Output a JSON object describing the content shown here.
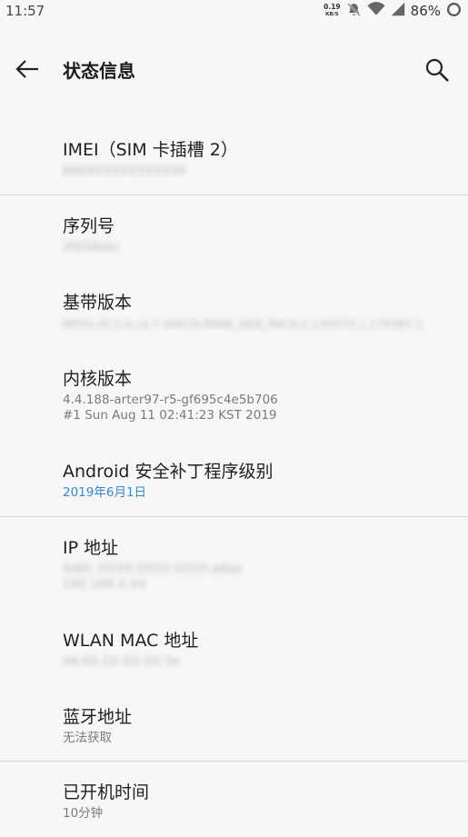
{
  "status_bar": {
    "time": "11:57",
    "net_speed_value": "0.19",
    "net_speed_unit": "KB/S",
    "battery_percent": "86%"
  },
  "app_bar": {
    "title": "状态信息"
  },
  "items": [
    {
      "title": "IMEI（SIM 卡插槽 2）",
      "sub": "866XXXXXXXXXXX6"
    },
    {
      "title": "序列号",
      "sub": "3fd34bbc"
    },
    {
      "title": "基带版本",
      "sub": "MPSS.AT.2.0.c4.7-00070-8998_GEN_PACK-2.132073.1.179387.1"
    },
    {
      "title": "内核版本",
      "sub": "4.4.188-arter97-r5-gf695c4e5b706",
      "sub2": "#1 Sun Aug 11 02:41:23 KST 2019"
    },
    {
      "title": "Android 安全补丁程序级别",
      "sub": "2019年6月1日"
    },
    {
      "title": "IP 地址",
      "sub": "fe80::XXXX:XXXX:XXXX:a8ae",
      "sub2": "192.168.X.XX"
    },
    {
      "title": "WLAN MAC 地址",
      "sub": "94:65:2X:XX:XX:3e"
    },
    {
      "title": "蓝牙地址",
      "sub": "无法获取"
    },
    {
      "title": "已开机时间",
      "sub": "10分钟"
    }
  ],
  "colors": {
    "background": "#f7f7f7",
    "accent": "#2e8ad6",
    "divider": "#d9d9d9"
  }
}
